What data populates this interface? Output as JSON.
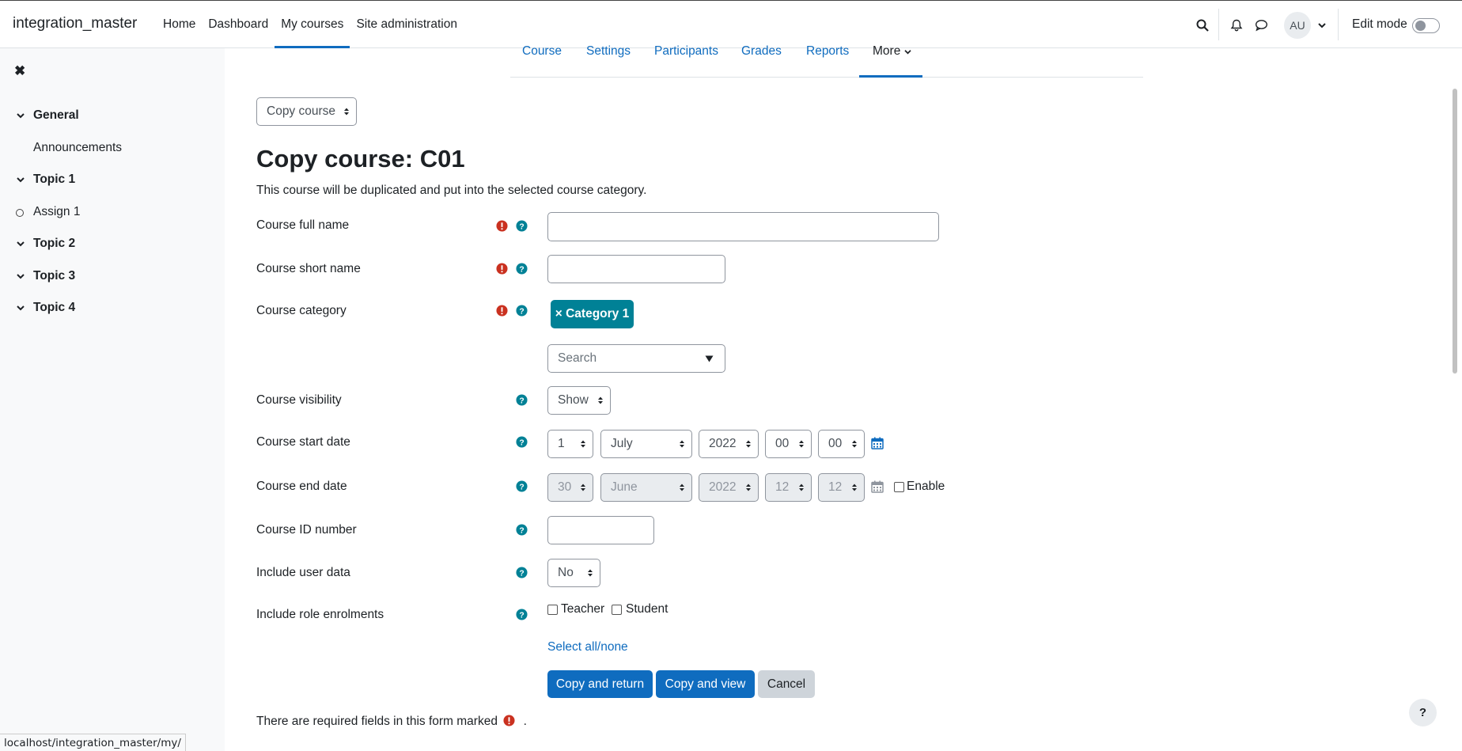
{
  "navbar": {
    "brand": "integration_master",
    "items": [
      {
        "label": "Home",
        "active": false
      },
      {
        "label": "Dashboard",
        "active": false
      },
      {
        "label": "My courses",
        "active": true
      },
      {
        "label": "Site administration",
        "active": false
      }
    ],
    "avatar_initials": "AU",
    "edit_mode_label": "Edit mode",
    "edit_mode_on": false
  },
  "drawer": {
    "items": [
      {
        "label": "General",
        "type": "section"
      },
      {
        "label": "Announcements",
        "type": "activity-forum"
      },
      {
        "label": "Topic 1",
        "type": "section"
      },
      {
        "label": "Assign 1",
        "type": "activity-assign"
      },
      {
        "label": "Topic 2",
        "type": "section"
      },
      {
        "label": "Topic 3",
        "type": "section"
      },
      {
        "label": "Topic 4",
        "type": "section"
      }
    ]
  },
  "secondary_nav": {
    "tabs": [
      "Course",
      "Settings",
      "Participants",
      "Grades",
      "Reports"
    ],
    "more_label": "More"
  },
  "action_select": {
    "value": "Copy course"
  },
  "page": {
    "title": "Copy course: C01",
    "intro": "This course will be duplicated and put into the selected course category."
  },
  "form": {
    "full_name_label": "Course full name",
    "short_name_label": "Course short name",
    "category_label": "Course category",
    "category_chip": "× Category 1",
    "category_search_placeholder": "Search",
    "visibility_label": "Course visibility",
    "visibility_value": "Show",
    "start_date_label": "Course start date",
    "start_date": {
      "day": "1",
      "month": "July",
      "year": "2022",
      "hour": "00",
      "minute": "00"
    },
    "end_date_label": "Course end date",
    "end_date": {
      "day": "30",
      "month": "June",
      "year": "2022",
      "hour": "12",
      "minute": "12"
    },
    "end_date_enable_label": "Enable",
    "id_number_label": "Course ID number",
    "user_data_label": "Include user data",
    "user_data_value": "No",
    "role_enrolments_label": "Include role enrolments",
    "role_teacher": "Teacher",
    "role_student": "Student",
    "select_all_none": "Select all/none",
    "buttons": {
      "copy_return": "Copy and return",
      "copy_view": "Copy and view",
      "cancel": "Cancel"
    },
    "required_note_prefix": "There are required fields in this form marked",
    "required_note_suffix": "."
  },
  "status_url": "localhost/integration_master/my/",
  "help_button": "?",
  "colors": {
    "brand_blue": "#0f6cbf",
    "chip_teal": "#008196",
    "required_red": "#ca3120",
    "help_teal": "#008196"
  }
}
